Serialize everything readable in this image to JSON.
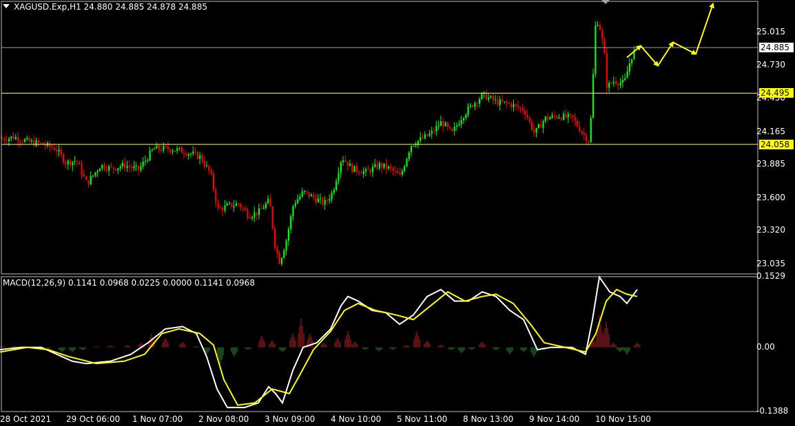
{
  "window": {
    "symbol_header": "XAGUSD.Exp,H1  24.880 24.885 24.878 24.885",
    "macd_header": "MACD(12,26,9) 0.1141 0.0968 0.0225 0.0000 0.1141 0.0968"
  },
  "colors": {
    "background": "#000000",
    "bull_candle": "#00ff00",
    "bear_candle": "#ff0000",
    "level_line": "#ffff66",
    "price_line": "#9aa3ad",
    "macd_line": "#ffffff",
    "signal_line": "#ffff00",
    "hist_positive": "#b22222",
    "hist_negative": "#2e8b2e",
    "projection_arrows": "#ffff00"
  },
  "chart_data": [
    {
      "type": "candlestick",
      "symbol": "XAGUSD.Exp",
      "timeframe": "H1",
      "ylim": [
        22.95,
        25.28
      ],
      "yticks": [
        "25.015",
        "24.730",
        "24.450",
        "24.165",
        "23.885",
        "23.600",
        "23.320",
        "23.035"
      ],
      "price_line": "24.885",
      "levels": [
        "24.495",
        "24.058"
      ],
      "close_path": [
        [
          0,
          24.1
        ],
        [
          20,
          24.12
        ],
        [
          40,
          24.08
        ],
        [
          60,
          24.06
        ],
        [
          80,
          24.02
        ],
        [
          95,
          23.9
        ],
        [
          110,
          23.92
        ],
        [
          125,
          23.72
        ],
        [
          145,
          23.88
        ],
        [
          160,
          23.85
        ],
        [
          180,
          23.88
        ],
        [
          200,
          23.84
        ],
        [
          222,
          24.02
        ],
        [
          245,
          24.02
        ],
        [
          265,
          24.0
        ],
        [
          290,
          23.95
        ],
        [
          305,
          23.8
        ],
        [
          315,
          23.5
        ],
        [
          330,
          23.53
        ],
        [
          345,
          23.55
        ],
        [
          360,
          23.45
        ],
        [
          375,
          23.48
        ],
        [
          390,
          23.58
        ],
        [
          398,
          23.2
        ],
        [
          405,
          23.05
        ],
        [
          415,
          23.25
        ],
        [
          425,
          23.55
        ],
        [
          440,
          23.65
        ],
        [
          455,
          23.6
        ],
        [
          470,
          23.55
        ],
        [
          482,
          23.65
        ],
        [
          495,
          23.95
        ],
        [
          510,
          23.85
        ],
        [
          530,
          23.82
        ],
        [
          550,
          23.88
        ],
        [
          565,
          23.85
        ],
        [
          580,
          23.78
        ],
        [
          595,
          24.05
        ],
        [
          610,
          24.1
        ],
        [
          625,
          24.15
        ],
        [
          640,
          24.25
        ],
        [
          655,
          24.15
        ],
        [
          670,
          24.3
        ],
        [
          685,
          24.4
        ],
        [
          700,
          24.48
        ],
        [
          720,
          24.42
        ],
        [
          740,
          24.4
        ],
        [
          760,
          24.35
        ],
        [
          775,
          24.15
        ],
        [
          790,
          24.28
        ],
        [
          810,
          24.3
        ],
        [
          830,
          24.28
        ],
        [
          845,
          24.15
        ],
        [
          855,
          24.08
        ],
        [
          860,
          24.65
        ],
        [
          864,
          25.15
        ],
        [
          870,
          25.05
        ],
        [
          876,
          24.85
        ],
        [
          880,
          24.55
        ],
        [
          890,
          24.6
        ],
        [
          905,
          24.58
        ],
        [
          915,
          24.8
        ],
        [
          922,
          24.88
        ]
      ],
      "projection_path": [
        [
          910,
          24.8
        ],
        [
          930,
          24.9
        ],
        [
          955,
          24.73
        ],
        [
          977,
          24.93
        ],
        [
          1010,
          24.83
        ],
        [
          1035,
          25.26
        ]
      ]
    },
    {
      "type": "line",
      "title": "MACD(12,26,9)",
      "ylim": [
        -0.1388,
        0.1529
      ],
      "yticks": [
        "0.1529",
        "0.00",
        "-0.1388"
      ],
      "series": [
        {
          "name": "MACD",
          "points": [
            [
              0,
              -0.005
            ],
            [
              30,
              0.0
            ],
            [
              60,
              0.0
            ],
            [
              90,
              -0.02
            ],
            [
              105,
              -0.03
            ],
            [
              125,
              -0.035
            ],
            [
              160,
              -0.03
            ],
            [
              190,
              -0.015
            ],
            [
              215,
              0.01
            ],
            [
              240,
              0.04
            ],
            [
              265,
              0.045
            ],
            [
              285,
              0.03
            ],
            [
              300,
              -0.02
            ],
            [
              315,
              -0.09
            ],
            [
              330,
              -0.13
            ],
            [
              355,
              -0.13
            ],
            [
              375,
              -0.12
            ],
            [
              390,
              -0.085
            ],
            [
              400,
              -0.1
            ],
            [
              410,
              -0.12
            ],
            [
              425,
              -0.05
            ],
            [
              440,
              0.0
            ],
            [
              460,
              0.01
            ],
            [
              480,
              0.04
            ],
            [
              495,
              0.09
            ],
            [
              505,
              0.11
            ],
            [
              520,
              0.1
            ],
            [
              540,
              0.08
            ],
            [
              560,
              0.075
            ],
            [
              580,
              0.05
            ],
            [
              600,
              0.07
            ],
            [
              620,
              0.11
            ],
            [
              640,
              0.125
            ],
            [
              660,
              0.1
            ],
            [
              680,
              0.1
            ],
            [
              700,
              0.12
            ],
            [
              720,
              0.11
            ],
            [
              740,
              0.08
            ],
            [
              760,
              0.06
            ],
            [
              780,
              -0.005
            ],
            [
              800,
              0.0
            ],
            [
              830,
              0.0
            ],
            [
              850,
              -0.015
            ],
            [
              860,
              0.06
            ],
            [
              870,
              0.152
            ],
            [
              885,
              0.12
            ],
            [
              900,
              0.11
            ],
            [
              910,
              0.095
            ],
            [
              925,
              0.125
            ]
          ]
        },
        {
          "name": "Signal",
          "points": [
            [
              0,
              -0.01
            ],
            [
              40,
              0.0
            ],
            [
              70,
              -0.005
            ],
            [
              100,
              -0.02
            ],
            [
              140,
              -0.035
            ],
            [
              180,
              -0.03
            ],
            [
              210,
              -0.015
            ],
            [
              235,
              0.03
            ],
            [
              260,
              0.04
            ],
            [
              290,
              0.03
            ],
            [
              310,
              0.005
            ],
            [
              325,
              -0.07
            ],
            [
              345,
              -0.125
            ],
            [
              370,
              -0.12
            ],
            [
              395,
              -0.09
            ],
            [
              420,
              -0.1
            ],
            [
              435,
              -0.06
            ],
            [
              455,
              -0.005
            ],
            [
              480,
              0.035
            ],
            [
              500,
              0.08
            ],
            [
              520,
              0.095
            ],
            [
              545,
              0.08
            ],
            [
              575,
              0.07
            ],
            [
              600,
              0.06
            ],
            [
              625,
              0.09
            ],
            [
              650,
              0.12
            ],
            [
              675,
              0.1
            ],
            [
              700,
              0.11
            ],
            [
              720,
              0.115
            ],
            [
              745,
              0.095
            ],
            [
              770,
              0.05
            ],
            [
              790,
              0.01
            ],
            [
              820,
              0.0
            ],
            [
              850,
              -0.01
            ],
            [
              865,
              0.03
            ],
            [
              880,
              0.1
            ],
            [
              895,
              0.125
            ],
            [
              910,
              0.115
            ],
            [
              925,
              0.11
            ]
          ]
        }
      ],
      "histogram": [
        [
          5,
          0.003
        ],
        [
          20,
          0.003
        ],
        [
          35,
          0.003
        ],
        [
          50,
          0.002
        ],
        [
          70,
          -0.003
        ],
        [
          90,
          -0.01
        ],
        [
          105,
          -0.01
        ],
        [
          120,
          -0.006
        ],
        [
          140,
          0.002
        ],
        [
          160,
          0.004
        ],
        [
          185,
          0.005
        ],
        [
          205,
          0.01
        ],
        [
          220,
          0.03
        ],
        [
          240,
          0.02
        ],
        [
          265,
          0.012
        ],
        [
          285,
          0.003
        ],
        [
          300,
          -0.015
        ],
        [
          320,
          -0.035
        ],
        [
          340,
          -0.02
        ],
        [
          360,
          -0.005
        ],
        [
          380,
          0.025
        ],
        [
          395,
          0.015
        ],
        [
          410,
          -0.01
        ],
        [
          425,
          0.03
        ],
        [
          437,
          0.062
        ],
        [
          450,
          0.03
        ],
        [
          470,
          0.01
        ],
        [
          490,
          0.02
        ],
        [
          505,
          0.035
        ],
        [
          515,
          0.012
        ],
        [
          530,
          -0.005
        ],
        [
          550,
          -0.008
        ],
        [
          570,
          -0.005
        ],
        [
          590,
          0.005
        ],
        [
          605,
          0.035
        ],
        [
          620,
          0.015
        ],
        [
          640,
          0.006
        ],
        [
          655,
          -0.006
        ],
        [
          670,
          -0.012
        ],
        [
          685,
          -0.005
        ],
        [
          700,
          0.012
        ],
        [
          720,
          -0.006
        ],
        [
          740,
          -0.015
        ],
        [
          760,
          -0.01
        ],
        [
          775,
          -0.02
        ],
        [
          790,
          -0.006
        ],
        [
          805,
          -0.002
        ],
        [
          820,
          0.004
        ],
        [
          835,
          0.002
        ],
        [
          850,
          -0.003
        ],
        [
          860,
          0.022
        ],
        [
          870,
          0.068
        ],
        [
          880,
          0.055
        ],
        [
          890,
          0.01
        ],
        [
          900,
          -0.01
        ],
        [
          910,
          -0.015
        ],
        [
          925,
          0.01
        ]
      ]
    }
  ],
  "x_axis": {
    "labels": [
      "28 Oct 2021",
      "29 Oct 06:00",
      "1 Nov 07:00",
      "2 Nov 08:00",
      "3 Nov 09:00",
      "4 Nov 10:00",
      "5 Nov 11:00",
      "8 Nov 13:00",
      "9 Nov 14:00",
      "10 Nov 15:00"
    ]
  }
}
